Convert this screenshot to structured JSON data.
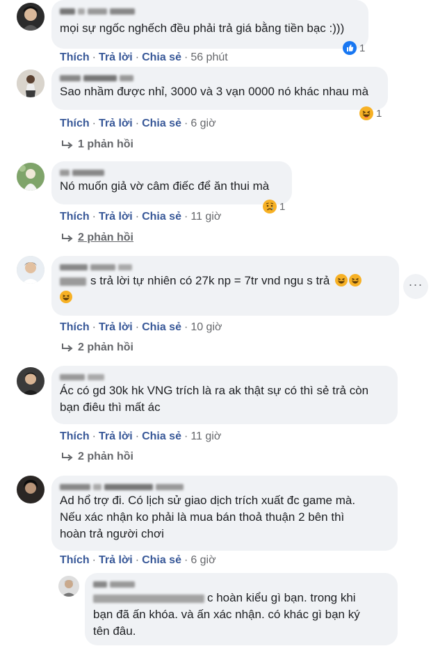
{
  "colors": {
    "action_link": "#385898",
    "meta_text": "#65676b",
    "bubble_bg": "#f0f2f5",
    "like_blue": "#1877f2",
    "haha_yellow": "#f7b125"
  },
  "actions": {
    "like": "Thích",
    "reply": "Trả lời",
    "share": "Chia sẻ",
    "separator": "·"
  },
  "comments": [
    {
      "text": "mọi sự ngốc nghếch đều phải trả giá bằng tiền bạc :)))",
      "time": "56 phút",
      "reaction": {
        "icon": "like-icon",
        "count": "1"
      }
    },
    {
      "text": "Sao nhầm được nhỉ, 3000 và 3 vạn 0000 nó khác nhau mà",
      "time": "6 giờ",
      "reaction": {
        "icon": "haha-icon",
        "count": "1"
      },
      "replies": "1 phản hồi"
    },
    {
      "text": "Nó muốn giả vờ câm điếc để ăn thui mà",
      "time": "11 giờ",
      "reaction": {
        "icon": "sad-icon",
        "count": "1"
      },
      "replies": "2 phản hồi"
    },
    {
      "text": "s trả lời tự nhiên có 27k np = 7tr vnd ngu s trả",
      "time": "10 giờ",
      "replies": "2 phản hồi",
      "more_label": "···"
    },
    {
      "text_line1": "Ác có gd 30k hk VNG trích là ra ak thật sự có thì sẻ trả còn",
      "text_line2": "bạn điêu thì mất ác",
      "time": "11 giờ",
      "replies": "2 phản hồi"
    },
    {
      "text_line1": "Ad hổ trợ đi. Có lịch sử giao dịch trích xuất đc game mà.",
      "text_line2": "Nếu xác nhận ko phải là mua bán thoả thuận 2 bên thì",
      "text_line3": "hoàn trả người chơi",
      "time": "6 giờ"
    }
  ],
  "reply": {
    "text_line1": "c hoàn kiểu gì bạn. trong khi",
    "text_line2": "bạn đã ấn khóa. và ấn xác nhận. có khác gì bạn ký",
    "text_line3": "tên đâu."
  }
}
